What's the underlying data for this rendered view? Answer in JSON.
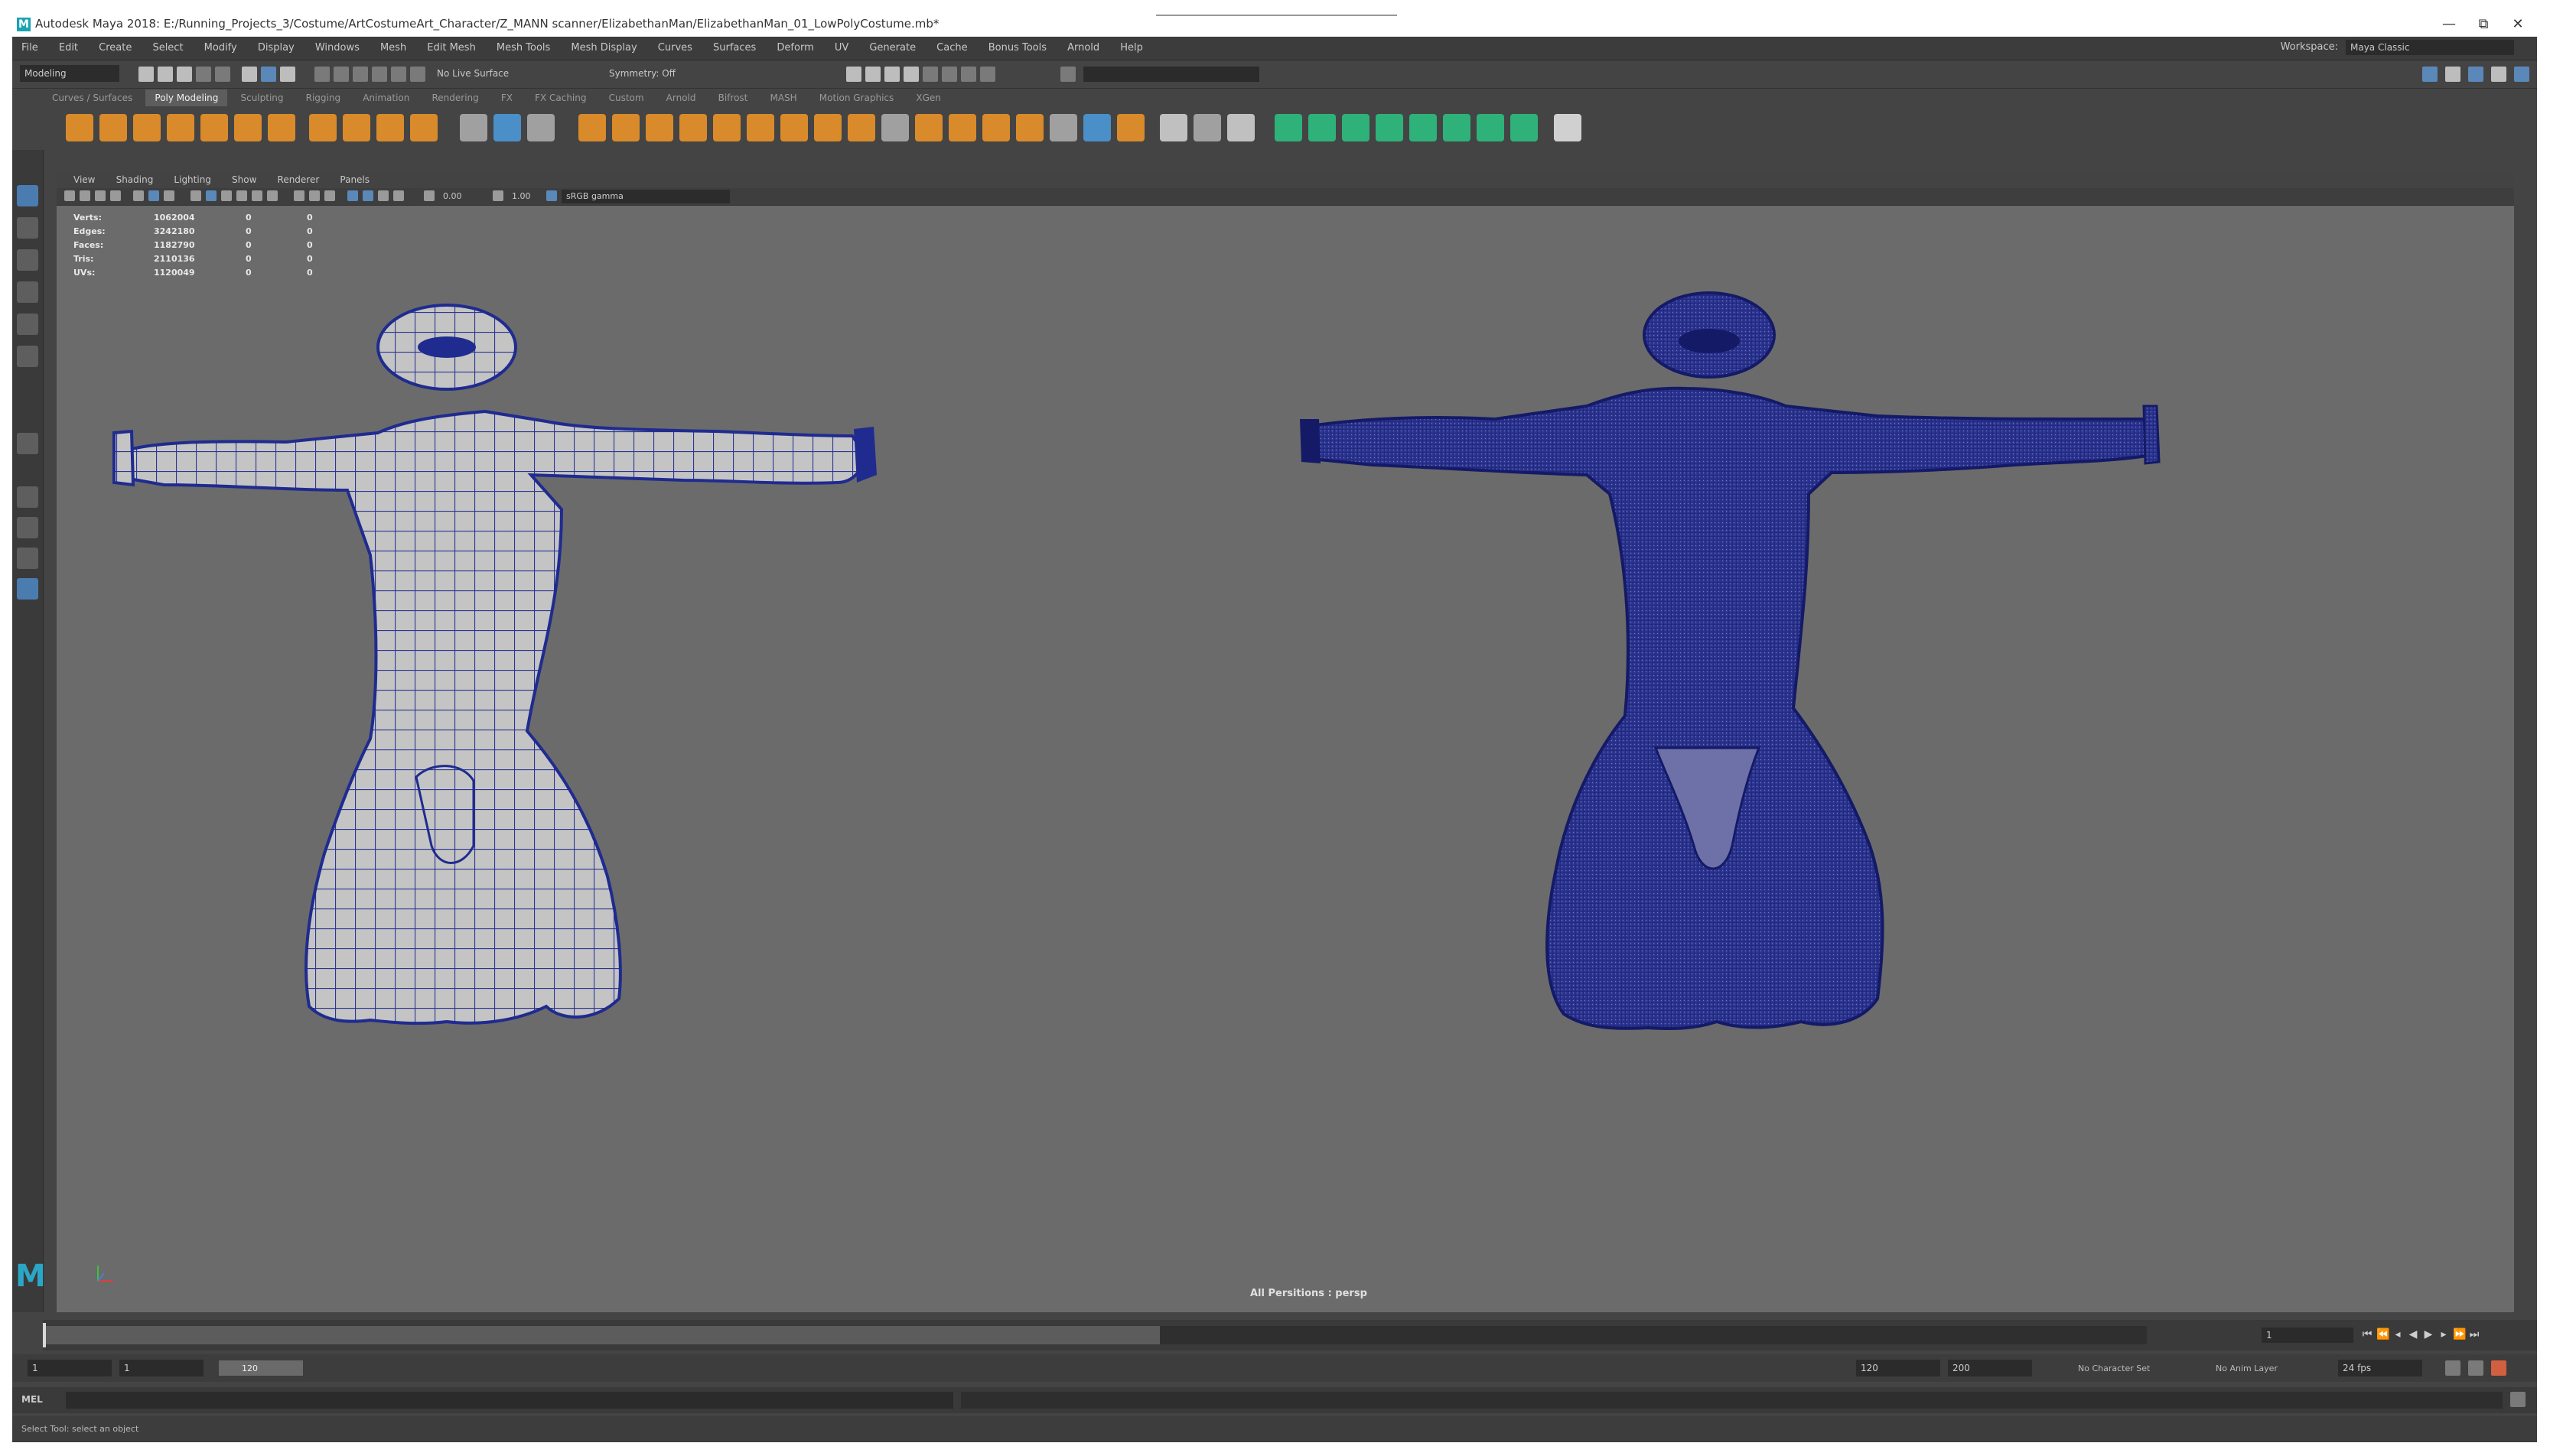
{
  "window": {
    "title": "Autodesk Maya 2018: E:/Running_Projects_3/Costume/ArtCostumeArt_Character/Z_MANN scanner/ElizabethanMan/ElizabethanMan_01_LowPolyCostume.mb*",
    "app_icon": "maya-icon",
    "controls": [
      "—",
      "⧉",
      "✕"
    ]
  },
  "menubar": {
    "items": [
      "File",
      "Edit",
      "Create",
      "Select",
      "Modify",
      "Display",
      "Windows",
      "Mesh",
      "Edit Mesh",
      "Mesh Tools",
      "Mesh Display",
      "Curves",
      "Surfaces",
      "Deform",
      "UV",
      "Generate",
      "Cache",
      "Bonus Tools",
      "Arnold",
      "Help"
    ],
    "workspace_label": "Workspace:",
    "workspace_value": "Maya Classic"
  },
  "statusline": {
    "mode": "Modeling",
    "live_surface": "No Live Surface",
    "symmetry": "Symmetry: Off"
  },
  "shelf": {
    "tabs": [
      "Curves / Surfaces",
      "Poly Modeling",
      "Sculpting",
      "Rigging",
      "Animation",
      "Rendering",
      "FX",
      "FX Caching",
      "Custom",
      "Arnold",
      "Bifrost",
      "MASH",
      "Motion Graphics",
      "XGen"
    ],
    "active_tab": "Poly Modeling"
  },
  "panel": {
    "menus": [
      "View",
      "Shading",
      "Lighting",
      "Show",
      "Renderer",
      "Panels"
    ],
    "camera_dropdown": "sRGB gamma",
    "field_a": "0.00",
    "field_b": "1.00"
  },
  "hud": {
    "rows": [
      {
        "label": "Verts:",
        "value": "1062004",
        "a": "0",
        "b": "0"
      },
      {
        "label": "Edges:",
        "value": "3242180",
        "a": "0",
        "b": "0"
      },
      {
        "label": "Faces:",
        "value": "1182790",
        "a": "0",
        "b": "0"
      },
      {
        "label": "Tris:",
        "value": "2110136",
        "a": "0",
        "b": "0"
      },
      {
        "label": "UVs:",
        "value": "1120049",
        "a": "0",
        "b": "0"
      }
    ]
  },
  "viewport": {
    "camera_label": "All Persitions : persp",
    "left_model": "low-poly-costume-wireframe",
    "right_model": "high-poly-costume-wireframe"
  },
  "timeline": {
    "current_frame": "1",
    "start_frame": "1",
    "end_frame": "120"
  },
  "range": {
    "start": "1",
    "start2": "1",
    "slider_label": "120",
    "end": "120",
    "end2": "200",
    "character_set": "No Character Set",
    "anim_layer": "No Anim Layer",
    "fps": "24 fps"
  },
  "cmdline": {
    "label": "MEL"
  },
  "helpline": {
    "text": "Select Tool: select an object"
  },
  "colors": {
    "viewport_bg": "#6b6b6b",
    "wire_blue": "#1f2b8f",
    "lowpoly_surface": "#c4c4c4",
    "highpoly_surface": "#2c3592",
    "maya_accent": "#2aa7c6"
  }
}
